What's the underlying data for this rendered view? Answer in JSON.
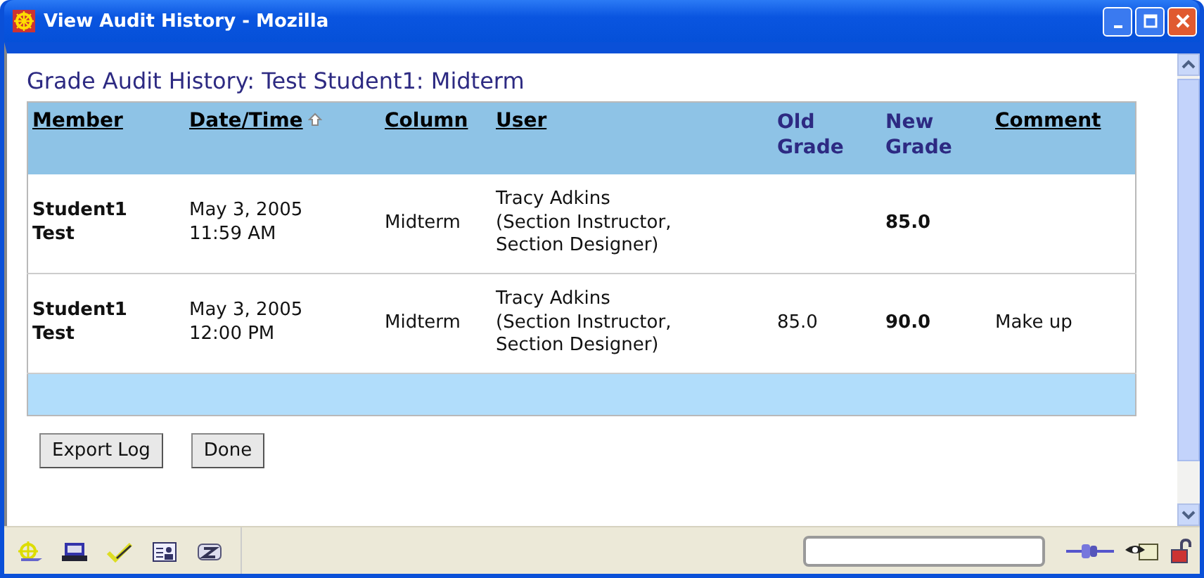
{
  "window": {
    "title": "View Audit History - Mozilla"
  },
  "page": {
    "heading": "Grade Audit History: Test Student1: Midterm"
  },
  "table": {
    "columns": [
      {
        "label": "Member",
        "kind": "link",
        "sorted": false
      },
      {
        "label": "Date/Time",
        "kind": "link",
        "sorted": true
      },
      {
        "label": "Column",
        "kind": "link",
        "sorted": false
      },
      {
        "label": "User",
        "kind": "link",
        "sorted": false
      },
      {
        "label": "Old Grade",
        "kind": "plain",
        "sorted": false
      },
      {
        "label": "New Grade",
        "kind": "plain",
        "sorted": false
      },
      {
        "label": "Comment",
        "kind": "link",
        "sorted": false
      }
    ],
    "rows": [
      {
        "member": "Student1 Test",
        "datetime": "May 3, 2005\n11:59 AM",
        "column": "Midterm",
        "user": "Tracy Adkins\n(Section Instructor,\nSection Designer)",
        "new_grade": "85.0"
      },
      {
        "member": "Student1 Test",
        "datetime": "May 3, 2005\n12:00 PM",
        "column": "Midterm",
        "user": "Tracy Adkins\n(Section Instructor,\nSection Designer)",
        "old_grade": "85.0",
        "new_grade": "90.0",
        "comment": "Make up"
      }
    ]
  },
  "buttons": [
    "Export Log",
    "Done"
  ]
}
